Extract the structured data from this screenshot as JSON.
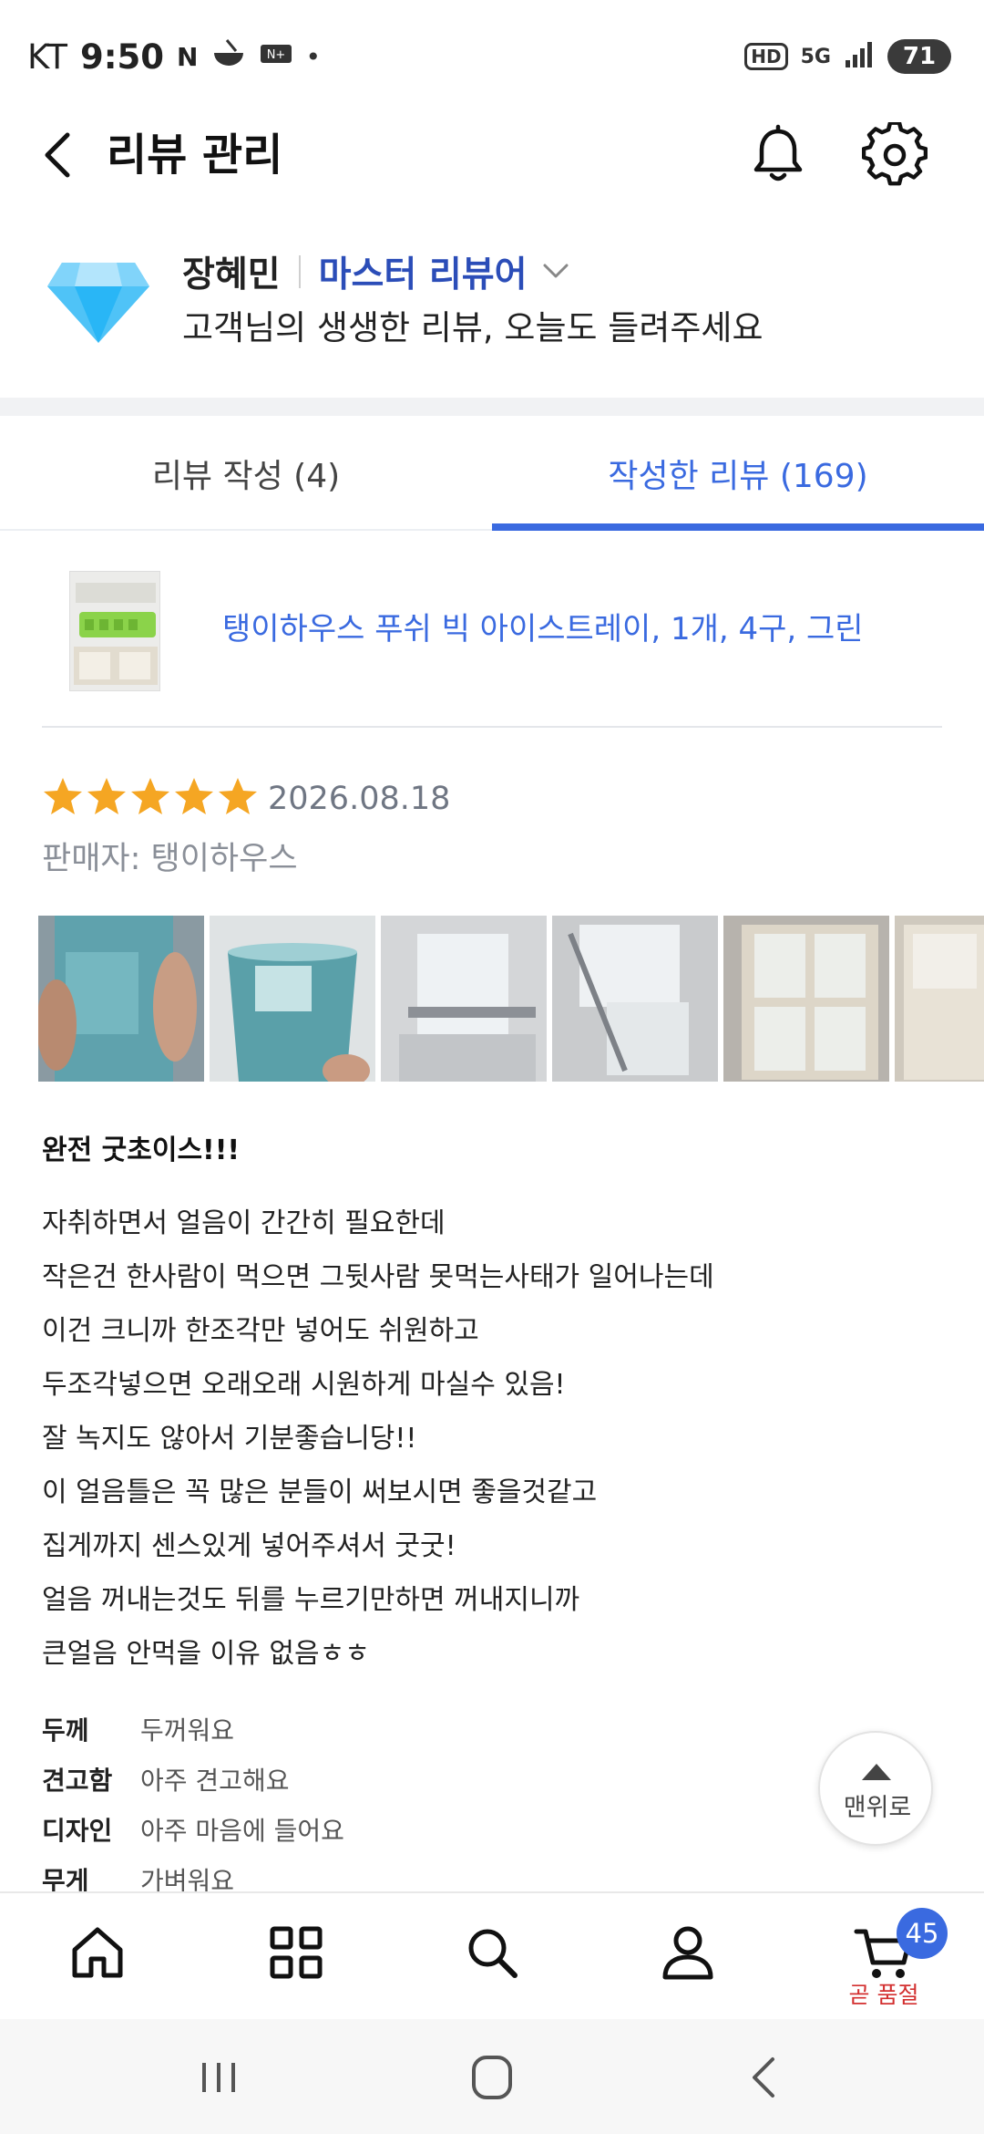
{
  "status_bar": {
    "carrier": "KT",
    "time": "9:50",
    "dot": "•",
    "hd_label": "HD",
    "network": "5G",
    "battery": "71"
  },
  "header": {
    "title": "리뷰 관리"
  },
  "profile": {
    "name": "장혜민",
    "level": "마스터 리뷰어",
    "message": "고객님의 생생한 리뷰, 오늘도 들려주세요"
  },
  "tabs": [
    {
      "label": "리뷰 작성 (4)",
      "active": false
    },
    {
      "label": "작성한 리뷰 (169)",
      "active": true
    }
  ],
  "product": {
    "name": "탱이하우스 푸쉬 빅 아이스트레이, 1개, 4구, 그린"
  },
  "review": {
    "rating": 5,
    "date": "2026.08.18",
    "seller": "판매자: 탱이하우스",
    "title": "완전 굿초이스!!!",
    "lines": [
      "자취하면서 얼음이 간간히 필요한데",
      "작은건 한사람이 먹으면 그뒷사람 못먹는사태가 일어나는데",
      "이건 크니까 한조각만 넣어도 쉬원하고",
      "두조각넣으면 오래오래 시원하게 마실수 있음!",
      "잘 녹지도 않아서 기분좋습니당!!",
      "이 얼음틀은 꼭 많은 분들이 써보시면 좋을것같고",
      "집게까지 센스있게 넣어주셔서 굿굿!",
      "얼음 꺼내는것도 뒤를 누르기만하면 꺼내지니까",
      "큰얼음 안먹을 이유 없음ㅎㅎ"
    ],
    "attributes": [
      {
        "label": "두께",
        "value": "두꺼워요"
      },
      {
        "label": "견고함",
        "value": "아주 견고해요"
      },
      {
        "label": "디자인",
        "value": "아주 마음에 들어요"
      },
      {
        "label": "무게",
        "value": "가벼워요"
      }
    ]
  },
  "top_button": {
    "label": "맨위로"
  },
  "bottom_nav": {
    "items": [
      "home-icon",
      "category-grid-icon",
      "search-icon",
      "my-account-icon",
      "cart-icon"
    ],
    "cart_count": "45",
    "cart_status": "곧 품절"
  },
  "colors": {
    "accent": "#3a6ae0",
    "level": "#2b4db8",
    "star": "#f5a623",
    "soldout": "#d32f2f"
  }
}
